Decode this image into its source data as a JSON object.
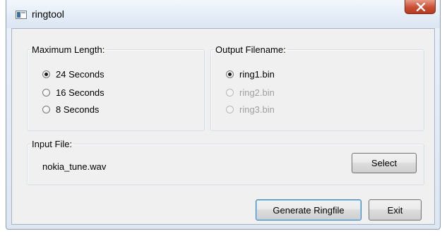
{
  "window": {
    "title": "ringtool",
    "icons": {
      "app": "app-window-icon",
      "close": "close-x-icon"
    },
    "colors": {
      "close_button": "#c94e32",
      "client_bg": "#f0f0f0"
    }
  },
  "max_length": {
    "legend": "Maximum Length:",
    "options": [
      {
        "label": "24 Seconds",
        "checked": true,
        "enabled": true
      },
      {
        "label": "16 Seconds",
        "checked": false,
        "enabled": true
      },
      {
        "label": "8 Seconds",
        "checked": false,
        "enabled": true
      }
    ]
  },
  "output": {
    "legend": "Output Filename:",
    "options": [
      {
        "label": "ring1.bin",
        "checked": true,
        "enabled": true
      },
      {
        "label": "ring2.bin",
        "checked": false,
        "enabled": false
      },
      {
        "label": "ring3.bin",
        "checked": false,
        "enabled": false
      }
    ]
  },
  "input_file": {
    "legend": "Input File:",
    "filename": "nokia_tune.wav",
    "select_label": "Select"
  },
  "actions": {
    "generate_label": "Generate Ringfile",
    "exit_label": "Exit"
  }
}
